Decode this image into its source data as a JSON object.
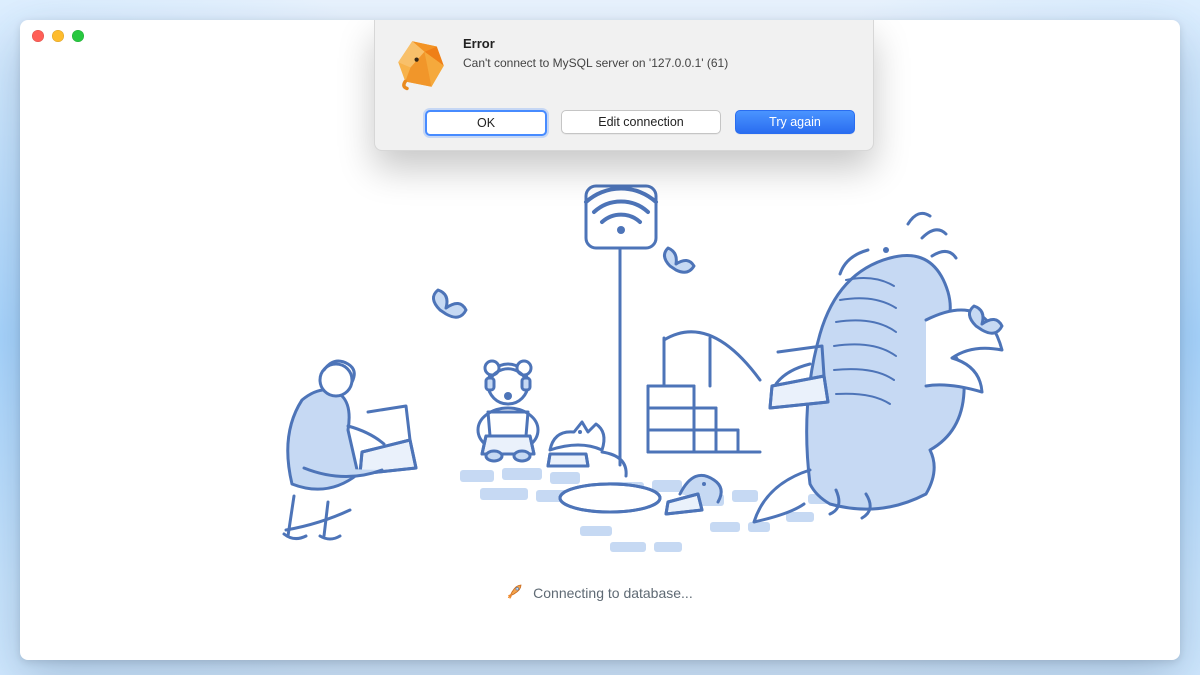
{
  "alert": {
    "title": "Error",
    "message": "Can't connect to MySQL server on '127.0.0.1' (61)",
    "buttons": {
      "ok": "OK",
      "edit": "Edit connection",
      "retry": "Try again"
    },
    "icon": "tableplus-app-icon"
  },
  "status": {
    "icon": "rocket-icon",
    "text": "Connecting to database..."
  },
  "window": {
    "traffic_lights": [
      "close",
      "minimize",
      "zoom"
    ]
  },
  "colors": {
    "illustration_stroke": "#4d74b8",
    "illustration_fill": "#c6d9f3",
    "primary_button": "#2a6df0",
    "focus_ring": "#478bff"
  }
}
